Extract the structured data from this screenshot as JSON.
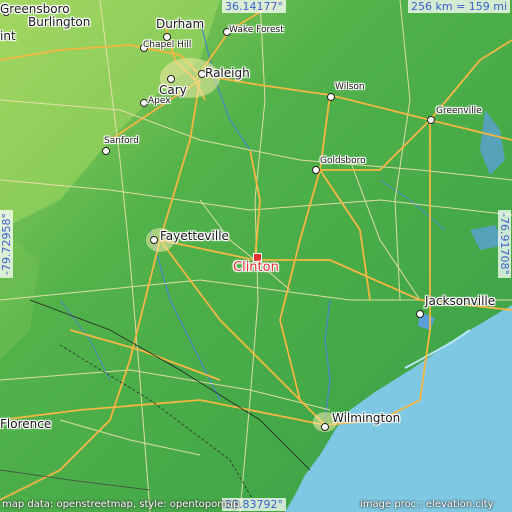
{
  "map": {
    "coords": {
      "top": "36.14177°",
      "bottom": "33.83792°",
      "left": "-79.72958°",
      "right": "-76.91708°"
    },
    "scale": "256 km = 159 mi",
    "attribution_left": "map data: openstreetmap, style: opentopomap",
    "attribution_right": "image proc.: elevation.city",
    "highlight_city": "Clinton",
    "cities": [
      {
        "id": "greensboro",
        "name": "Greensboro"
      },
      {
        "id": "burlington",
        "name": "Burlington"
      },
      {
        "id": "durham",
        "name": "Durham"
      },
      {
        "id": "wake-forest",
        "name": "Wake Forest"
      },
      {
        "id": "chapel-hill",
        "name": "Chapel Hill"
      },
      {
        "id": "raleigh",
        "name": "Raleigh"
      },
      {
        "id": "cary",
        "name": "Cary"
      },
      {
        "id": "apex",
        "name": "Apex"
      },
      {
        "id": "wilson",
        "name": "Wilson"
      },
      {
        "id": "greenville",
        "name": "Greenville"
      },
      {
        "id": "sanford",
        "name": "Sanford"
      },
      {
        "id": "goldsboro",
        "name": "Goldsboro"
      },
      {
        "id": "fayetteville",
        "name": "Fayetteville"
      },
      {
        "id": "jacksonville",
        "name": "Jacksonville"
      },
      {
        "id": "wilmington",
        "name": "Wilmington"
      },
      {
        "id": "florence",
        "name": "Florence"
      },
      {
        "id": "int",
        "name": "int"
      }
    ],
    "colors": {
      "land": "#3fa84a",
      "upland": "#8fcf5a",
      "ocean": "#7ec8e3",
      "roads_major": "#f5b642",
      "roads_minor": "#e0d9b0",
      "highlight": "#e53030",
      "coord_text": "#3b5fd0"
    }
  }
}
